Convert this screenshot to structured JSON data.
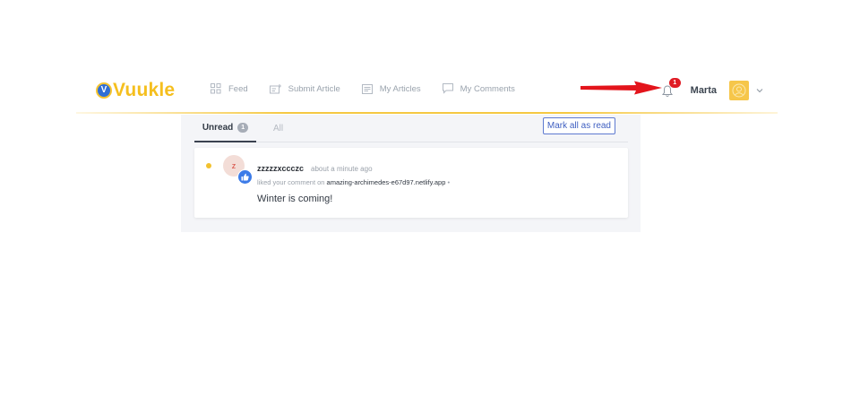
{
  "header": {
    "logo_text": "Vuukle",
    "logo_mark": "V",
    "nav": [
      {
        "label": "Feed",
        "icon": "grid-icon"
      },
      {
        "label": "Submit Article",
        "icon": "submit-article-icon"
      },
      {
        "label": "My Articles",
        "icon": "articles-icon"
      },
      {
        "label": "My Comments",
        "icon": "comment-icon"
      }
    ],
    "notification_count": "1",
    "username": "Marta"
  },
  "notifications": {
    "tabs": {
      "unread": "Unread",
      "unread_count": "1",
      "all": "All"
    },
    "mark_all_label": "Mark all as read",
    "items": [
      {
        "avatar_letter": "z",
        "user": "zzzzzxccczc",
        "time": "about a minute ago",
        "action_prefix": "liked your comment on",
        "site": "amazing-archimedes-e67d97.netlify.app",
        "action_suffix": " •",
        "comment": "Winter is coming!"
      }
    ]
  },
  "colors": {
    "brand_yellow": "#f5bf1e",
    "brand_blue": "#2f6fd6",
    "badge_red": "#e01b24",
    "unread_dot": "#f2c12e",
    "button_blue": "#3f5fc1"
  }
}
